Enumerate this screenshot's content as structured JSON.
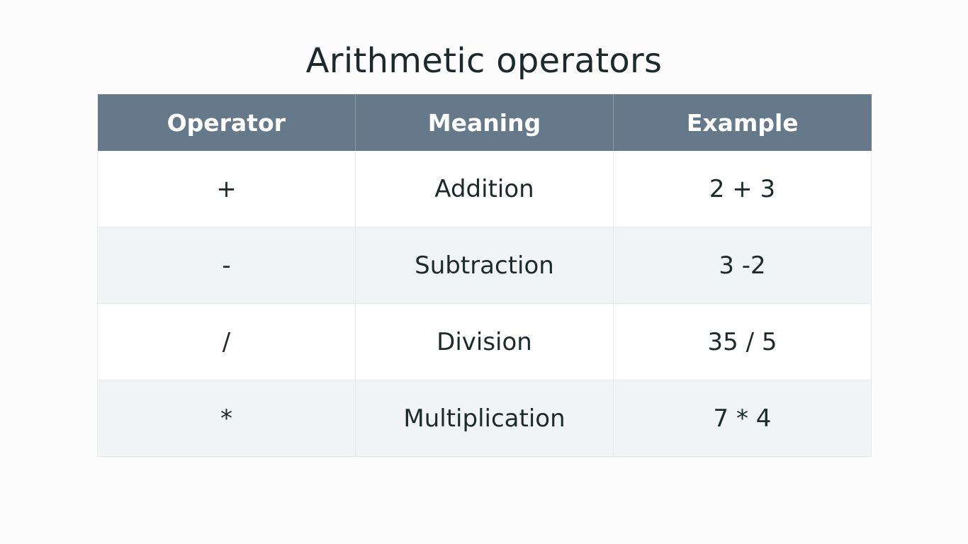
{
  "title": "Arithmetic operators",
  "table": {
    "headers": [
      "Operator",
      "Meaning",
      "Example"
    ],
    "rows": [
      {
        "operator": "+",
        "meaning": "Addition",
        "example": "2 + 3"
      },
      {
        "operator": "-",
        "meaning": "Subtraction",
        "example": "3 -2"
      },
      {
        "operator": "/",
        "meaning": "Division",
        "example": "35 / 5"
      },
      {
        "operator": "*",
        "meaning": "Multiplication",
        "example": "7 * 4"
      }
    ]
  },
  "colors": {
    "header_bg": "#66798a",
    "header_text": "#ffffff",
    "row_alt_bg": "#f0f4f5",
    "row_bg": "#ffffff",
    "text": "#1c2a2c"
  }
}
